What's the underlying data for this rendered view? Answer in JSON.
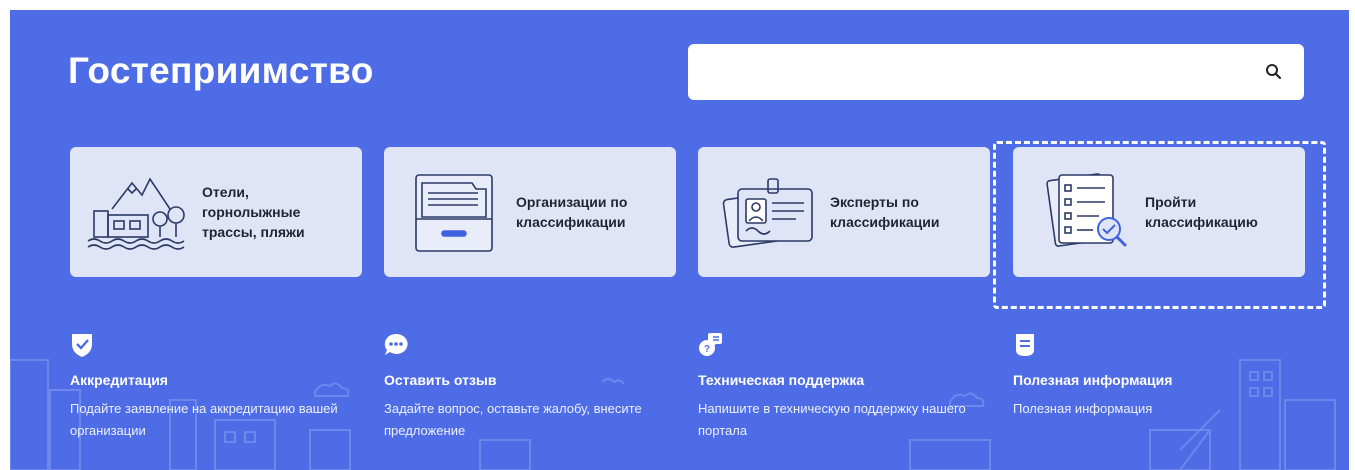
{
  "page": {
    "title": "Гостеприимство"
  },
  "search": {
    "placeholder": "",
    "value": "",
    "icon": "search-icon"
  },
  "cards": [
    {
      "label": "Отели, горнолыжные трассы, пляжи",
      "icon": "hotel-mountains-illustration"
    },
    {
      "label": "Организации по классификации",
      "icon": "archive-drawer-illustration"
    },
    {
      "label": "Эксперты по классификации",
      "icon": "id-badge-illustration"
    },
    {
      "label": "Пройти классификацию",
      "icon": "checklist-magnifier-illustration"
    }
  ],
  "info": [
    {
      "title": "Аккредитация",
      "desc": "Подайте заявление на аккредитацию вашей организации",
      "icon": "shield-check-icon"
    },
    {
      "title": "Оставить отзыв",
      "desc": "Задайте вопрос, оставьте жалобу, внесите предложение",
      "icon": "chat-bubble-icon"
    },
    {
      "title": "Техническая поддержка",
      "desc": "Напишите в техническую поддержку нашего портала",
      "icon": "support-chat-icon"
    },
    {
      "title": "Полезная информация",
      "desc": "Полезная информация",
      "icon": "document-icon"
    }
  ],
  "colors": {
    "background": "#4d6ce6",
    "card": "#dfe5f7",
    "text_dark": "#1f2430",
    "text_light": "#ffffff"
  }
}
